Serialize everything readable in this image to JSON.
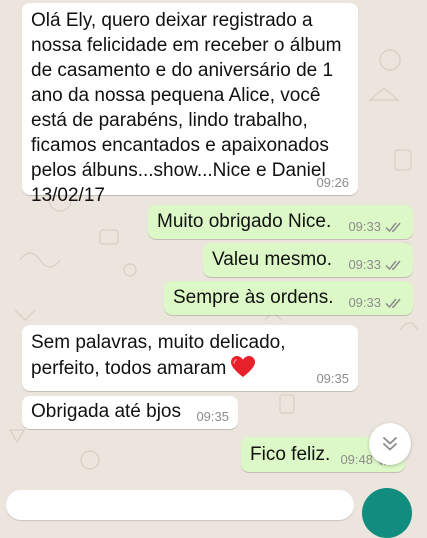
{
  "colors": {
    "wallpaper": "#ece5dd",
    "incoming_bubble": "#ffffff",
    "outgoing_bubble": "#dcf8c6",
    "meta_text": "#8c8c8c",
    "accent": "#128c7e",
    "heart": "#e8202c"
  },
  "messages": [
    {
      "direction": "incoming",
      "text": "Olá Ely, quero deixar registrado a\nnossa felicidade em receber o álbum\nde casamento e do aniversário de 1\nano da nossa pequena Alice, você\nestá de parabéns, lindo trabalho,\nficamos encantados e apaixonados\npelos álbuns...show...Nice e Daniel\n13/02/17",
      "time": "09:26"
    },
    {
      "direction": "outgoing",
      "text": "Muito obrigado Nice.",
      "time": "09:33",
      "status_icon": "double-check-icon"
    },
    {
      "direction": "outgoing",
      "text": "Valeu mesmo.",
      "time": "09:33",
      "status_icon": "double-check-icon"
    },
    {
      "direction": "outgoing",
      "text": "Sempre às ordens.",
      "time": "09:33",
      "status_icon": "double-check-icon"
    },
    {
      "direction": "incoming",
      "text_line1": "Sem palavras, muito delicado,",
      "text_line2": "perfeito, todos amaram",
      "emoji": "red-heart-icon",
      "time": "09:35"
    },
    {
      "direction": "incoming",
      "text": "Obrigada até bjos",
      "time": "09:35"
    },
    {
      "direction": "outgoing",
      "text": "Fico feliz.",
      "time": "09:48",
      "status_icon": "double-check-icon"
    }
  ],
  "controls": {
    "scroll_down_icon": "double-chevron-down-icon",
    "composer": "message-input",
    "send_button_icon": "mic-icon"
  }
}
